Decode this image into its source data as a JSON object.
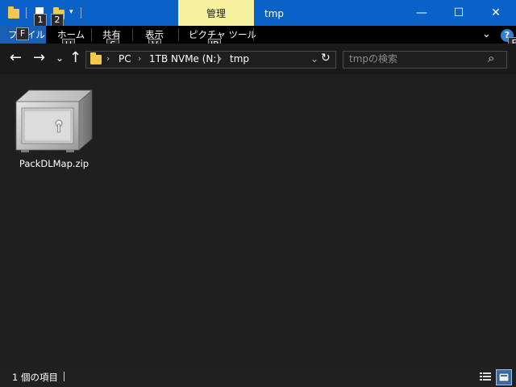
{
  "titlebar": {
    "manage_tab": "管理",
    "window_title": "tmp",
    "quick_access_keytips": [
      "1",
      "2"
    ],
    "accent": "#0a62c8",
    "manage_accent": "#f6f19f"
  },
  "window_controls": {
    "minimize": "—",
    "maximize": "☐",
    "close": "✕"
  },
  "ribbon": {
    "tabs": [
      {
        "label": "ファイル",
        "keytip": "F"
      },
      {
        "label": "ホーム",
        "keytip": "H"
      },
      {
        "label": "共有",
        "keytip": "S"
      },
      {
        "label": "表示",
        "keytip": "V"
      },
      {
        "label": "ピクチャ ツール",
        "keytip": "JP"
      }
    ],
    "expand_icon": "⌄",
    "help_icon": "?",
    "help_keytip": "E"
  },
  "nav": {
    "back": "←",
    "forward": "→",
    "recent": "⌄",
    "up": "↑",
    "breadcrumb": [
      "PC",
      "1TB NVMe (N:)",
      "tmp"
    ],
    "dropdown": "⌄",
    "refresh": "↻",
    "search_placeholder": "tmpの検索",
    "search_icon": "⌕"
  },
  "files": [
    {
      "name": "PackDLMap.zip",
      "icon": "safe-archive-icon"
    }
  ],
  "status": {
    "item_count": "1 個の項目"
  }
}
